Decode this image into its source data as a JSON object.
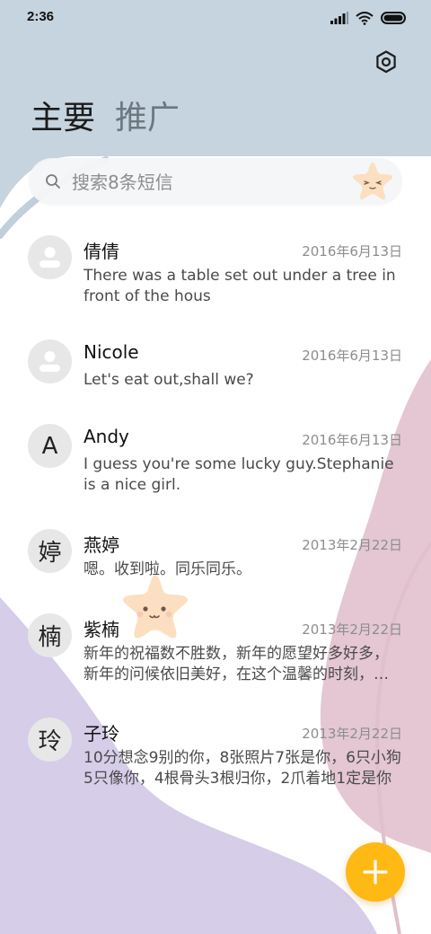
{
  "status_bar": {
    "time": "2:36",
    "icons": [
      "signal-icon",
      "wifi-icon",
      "battery-icon"
    ]
  },
  "header": {
    "settings_icon": "gear-icon",
    "tabs": [
      {
        "label": "主要",
        "active": true
      },
      {
        "label": "推广",
        "active": false
      }
    ]
  },
  "search": {
    "placeholder": "搜索8条短信",
    "value": ""
  },
  "conversations": [
    {
      "avatar_text": "",
      "avatar_icon": "person-icon",
      "name": "倩倩",
      "date": "2016年6月13日",
      "preview": "There was a table set out under a tree in front of the hous"
    },
    {
      "avatar_text": "",
      "avatar_icon": "person-icon",
      "name": "Nicole",
      "date": "2016年6月13日",
      "preview": "Let's eat out,shall we?"
    },
    {
      "avatar_text": "A",
      "name": "Andy",
      "date": "2016年6月13日",
      "preview": "I guess you're some lucky guy.Stephanie is a nice girl."
    },
    {
      "avatar_text": "婷",
      "name": "燕婷",
      "date": "2013年2月22日",
      "preview": "嗯。收到啦。同乐同乐。"
    },
    {
      "avatar_text": "楠",
      "name": "紫楠",
      "date": "2013年2月22日",
      "preview": "新年的祝福数不胜数，新年的愿望好多好多，新年的问候依旧美好，在这个温馨的时刻，愿你新年快乐"
    },
    {
      "avatar_text": "玲",
      "name": "子玲",
      "date": "2013年2月22日",
      "preview": "10分想念9别的你，8张照片7张是你，6只小狗5只像你，4根骨头3根归你，2爪着地1定是你"
    }
  ],
  "fab": {
    "icon": "plus-icon"
  },
  "colors": {
    "header_bg": "#c5d4df",
    "lavender": "#d6cde9",
    "pink": "#e4c7d3",
    "fab": "#ffb914",
    "star": "#fbdfc0"
  }
}
